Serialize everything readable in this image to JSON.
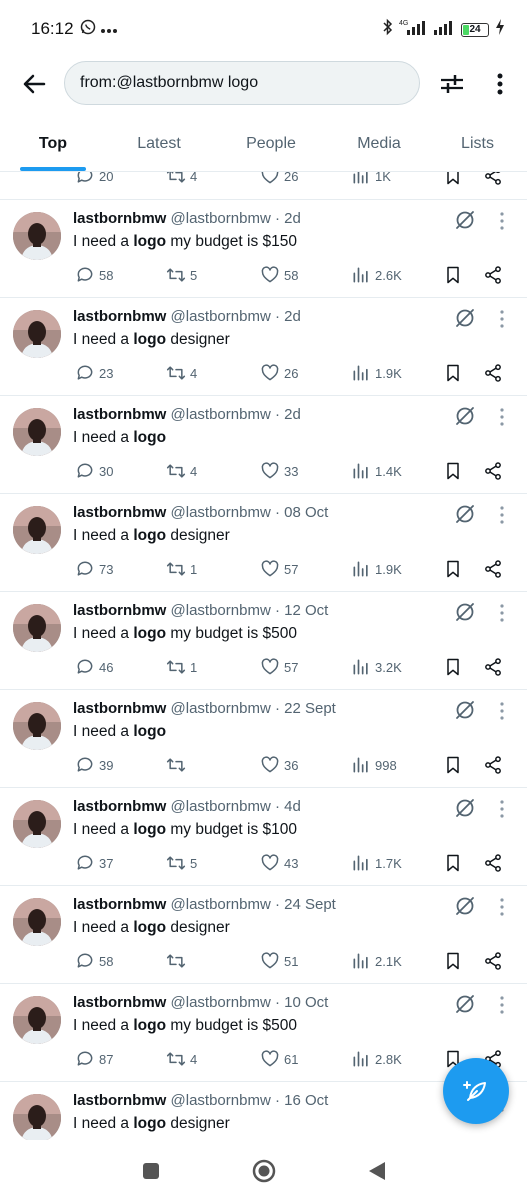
{
  "status_bar": {
    "time": "16:12",
    "network": "4G",
    "battery": "24",
    "icons": [
      "whatsapp-icon",
      "more-notifications-icon",
      "bluetooth-icon",
      "signal-icon",
      "battery-icon",
      "charging-icon"
    ]
  },
  "search": {
    "query": "from:@lastbornbmw logo"
  },
  "tabs": [
    {
      "label": "Top",
      "active": true
    },
    {
      "label": "Latest",
      "active": false
    },
    {
      "label": "People",
      "active": false
    },
    {
      "label": "Media",
      "active": false
    },
    {
      "label": "Lists",
      "active": false
    }
  ],
  "partial_tweet": {
    "replies": "20",
    "retweets": "4",
    "likes": "26",
    "views": "1K"
  },
  "tweets": [
    {
      "name": "lastbornbmw",
      "handle": "@lastbornbmw",
      "time": "· 2d",
      "text_before": "I need a ",
      "keyword": "logo",
      "text_after": " my budget is $150",
      "replies": "58",
      "retweets": "5",
      "likes": "58",
      "views": "2.6K"
    },
    {
      "name": "lastbornbmw",
      "handle": "@lastbornbmw",
      "time": "· 2d",
      "text_before": "I need a ",
      "keyword": "logo",
      "text_after": " designer",
      "replies": "23",
      "retweets": "4",
      "likes": "26",
      "views": "1.9K"
    },
    {
      "name": "lastbornbmw",
      "handle": "@lastbornbmw",
      "time": "· 2d",
      "text_before": "I need a ",
      "keyword": "logo",
      "text_after": "",
      "replies": "30",
      "retweets": "4",
      "likes": "33",
      "views": "1.4K"
    },
    {
      "name": "lastbornbmw",
      "handle": "@lastbornbmw",
      "time": "· 08 Oct",
      "text_before": "I need a ",
      "keyword": "logo",
      "text_after": " designer",
      "replies": "73",
      "retweets": "1",
      "likes": "57",
      "views": "1.9K"
    },
    {
      "name": "lastbornbmw",
      "handle": "@lastbornbmw",
      "time": "· 12 Oct",
      "text_before": "I need a ",
      "keyword": "logo",
      "text_after": " my budget is $500",
      "replies": "46",
      "retweets": "1",
      "likes": "57",
      "views": "3.2K"
    },
    {
      "name": "lastbornbmw",
      "handle": "@lastbornbmw",
      "time": "· 22 Sept",
      "text_before": "I need a ",
      "keyword": "logo",
      "text_after": "",
      "replies": "39",
      "retweets": "",
      "likes": "36",
      "views": "998"
    },
    {
      "name": "lastbornbmw",
      "handle": "@lastbornbmw",
      "time": "· 4d",
      "text_before": "I need a ",
      "keyword": "logo",
      "text_after": " my budget is $100",
      "replies": "37",
      "retweets": "5",
      "likes": "43",
      "views": "1.7K"
    },
    {
      "name": "lastbornbmw",
      "handle": "@lastbornbmw",
      "time": "· 24 Sept",
      "text_before": "I need a ",
      "keyword": "logo",
      "text_after": " designer",
      "replies": "58",
      "retweets": "",
      "likes": "51",
      "views": "2.1K"
    },
    {
      "name": "lastbornbmw",
      "handle": "@lastbornbmw",
      "time": "· 10 Oct",
      "text_before": "I need a ",
      "keyword": "logo",
      "text_after": " my budget is $500",
      "replies": "87",
      "retweets": "4",
      "likes": "61",
      "views": "2.8K"
    },
    {
      "name": "lastbornbmw",
      "handle": "@lastbornbmw",
      "time": "· 16 Oct",
      "text_before": "I need a ",
      "keyword": "logo",
      "text_after": " designer",
      "replies": "",
      "retweets": "",
      "likes": "",
      "views": ""
    }
  ],
  "colors": {
    "accent": "#1d9bf0",
    "text_primary": "#0f1419",
    "text_secondary": "#536471",
    "divider": "#e6ecf0",
    "search_bg": "#eff3f4"
  }
}
